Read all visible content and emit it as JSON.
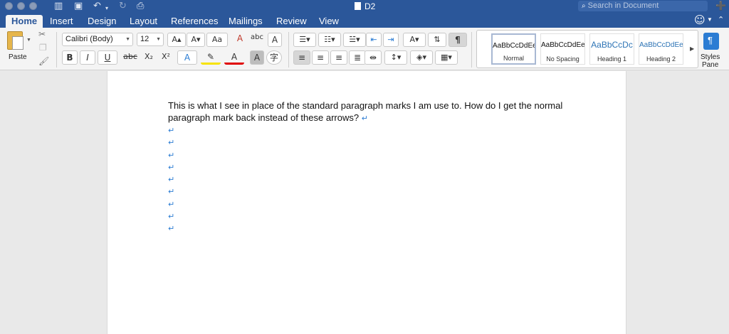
{
  "window": {
    "title": "D2",
    "search_placeholder": "Search in Document"
  },
  "tabs": [
    "Home",
    "Insert",
    "Design",
    "Layout",
    "References",
    "Mailings",
    "Review",
    "View"
  ],
  "ribbon": {
    "paste_label": "Paste",
    "font_name": "Calibri (Body)",
    "font_size": "12",
    "bold": "B",
    "italic": "I",
    "underline": "U",
    "strikethrough": "abc",
    "subscript": "X₂",
    "superscript": "X²",
    "grow_font": "A▴",
    "shrink_font": "A▾",
    "change_case": "Aa",
    "phonetic": "abc",
    "char_border": "A",
    "font_color": "A",
    "char_shading": "A",
    "enclose": "字",
    "pilcrow": "¶",
    "styles": [
      {
        "sample": "AaBbCcDdEe",
        "name": "Normal"
      },
      {
        "sample": "AaBbCcDdEe",
        "name": "No Spacing"
      },
      {
        "sample": "AaBbCcDc",
        "name": "Heading 1"
      },
      {
        "sample": "AaBbCcDdEe",
        "name": "Heading 2"
      }
    ],
    "styles_pane_label_1": "Styles",
    "styles_pane_label_2": "Pane"
  },
  "document": {
    "paragraph_text": "This is what I see in place of the standard paragraph marks I am use to. How do I get the normal paragraph mark back instead of these arrows?",
    "paragraph_mark": "↵",
    "empty_paragraph_count": 9
  },
  "colors": {
    "brand_blue": "#2b579a",
    "mark_blue": "#2b7cd3",
    "highlight_yellow": "#f7e300",
    "font_color_red": "#e00000"
  }
}
